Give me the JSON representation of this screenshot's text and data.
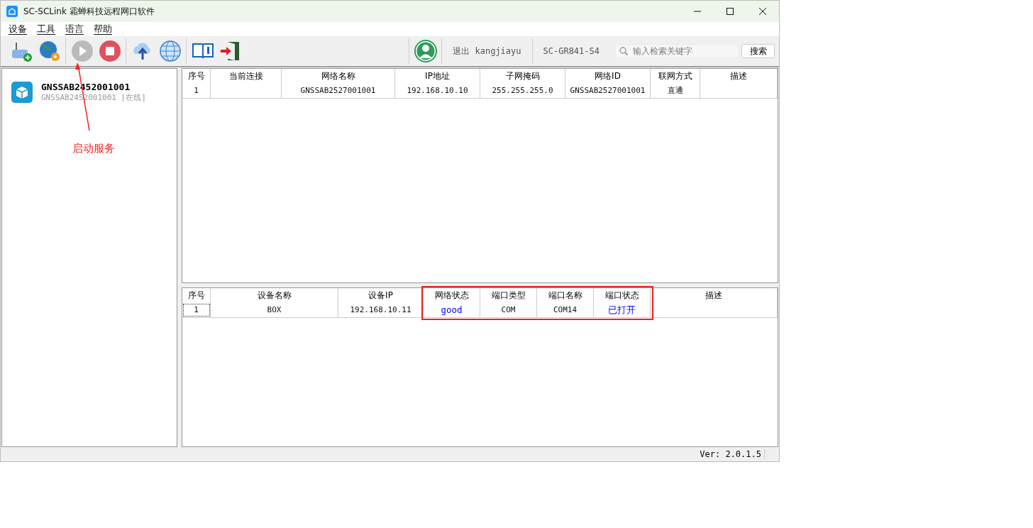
{
  "window": {
    "title": "SC-SCLink 霜蝉科技远程网口软件"
  },
  "menu": [
    "设备",
    "工具",
    "语言",
    "帮助"
  ],
  "toolbar": {
    "user": "退出 kangjiayu",
    "model": "SC-GR841-S4",
    "search": {
      "placeholder": "输入检索关键字"
    },
    "search_button": "搜索"
  },
  "devices": [
    {
      "name": "GNSSAB2452001001",
      "status": "GNSSAB2452001001 [在线]"
    }
  ],
  "network_table": {
    "columns": [
      "序号",
      "当前连接",
      "网络名称",
      "IP地址",
      "子网掩码",
      "网络ID",
      "联网方式",
      "描述"
    ],
    "rows": [
      {
        "focused": false,
        "cells": [
          "1",
          "",
          "GNSSAB2527001001",
          "192.168.10.10",
          "255.255.255.0",
          "GNSSAB2527001001",
          "直通",
          ""
        ]
      }
    ]
  },
  "device_table": {
    "columns": [
      "序号",
      "设备名称",
      "设备IP",
      "网络状态",
      "端口类型",
      "端口名称",
      "端口状态",
      "描述"
    ],
    "rows": [
      {
        "focused": true,
        "cells": [
          "1",
          "BOX",
          "192.168.10.11",
          {
            "text": "good",
            "color": "#0000ff"
          },
          "COM",
          "COM14",
          {
            "text": "已打开",
            "color": "#0000ff"
          },
          ""
        ]
      }
    ]
  },
  "status_bar": {
    "version": "Ver: 2.0.1.5"
  },
  "annotation": {
    "label": "启动服务"
  }
}
